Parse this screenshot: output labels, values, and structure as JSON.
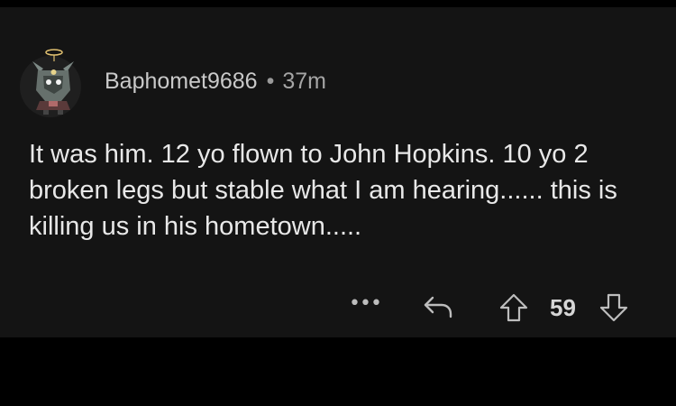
{
  "comment": {
    "username": "Baphomet9686",
    "separator": "•",
    "time_ago": "37m",
    "body": "It was him. 12 yo flown to John Hopkins. 10 yo 2 broken legs but stable what I am hearing...... this is killing us in his hometown.....",
    "avatar_icon": "character-avatar-icon"
  },
  "actions": {
    "more_label": "•••",
    "reply_icon": "reply-icon",
    "upvote_icon": "upvote-arrow-icon",
    "score": "59",
    "downvote_icon": "downvote-arrow-icon"
  },
  "colors": {
    "background": "#000000",
    "card": "#141414",
    "text": "#e8e8e8",
    "muted": "#a5a5a5"
  }
}
